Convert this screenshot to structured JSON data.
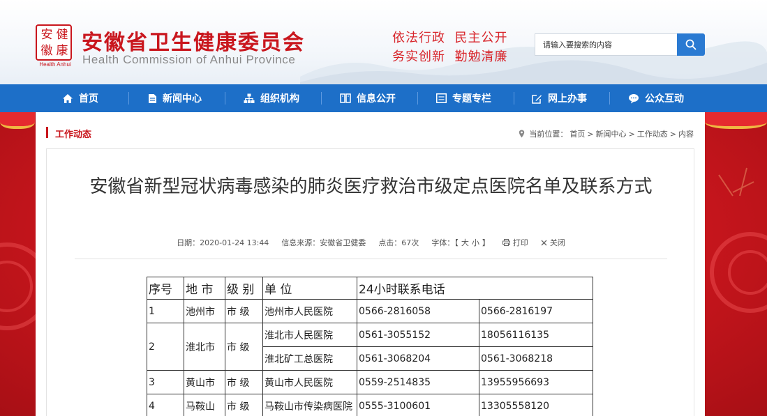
{
  "header": {
    "logo_chars": [
      "安",
      "健",
      "徽",
      "康"
    ],
    "logo_sub": "Health Anhui",
    "site_title": "安徽省卫生健康委员会",
    "site_en": "Health Commission of Anhui Province",
    "slogan_line1": "依法行政  民主公开",
    "slogan_line2": "务实创新  勤勉清廉",
    "search": {
      "placeholder": "请输入要搜索的内容",
      "icon": "search-icon"
    }
  },
  "nav": {
    "items": [
      {
        "label": "首页",
        "icon": "home-icon"
      },
      {
        "label": "新闻中心",
        "icon": "document-icon"
      },
      {
        "label": "组织机构",
        "icon": "org-chart-icon"
      },
      {
        "label": "信息公开",
        "icon": "book-icon"
      },
      {
        "label": "专题专栏",
        "icon": "list-icon"
      },
      {
        "label": "网上办事",
        "icon": "edit-icon"
      },
      {
        "label": "公众互动",
        "icon": "chat-icon"
      }
    ]
  },
  "section": {
    "title": "工作动态",
    "breadcrumb": {
      "prefix": "当前位置：",
      "items": [
        "首页",
        "新闻中心",
        "工作动态",
        "内容"
      ],
      "separator": ">"
    }
  },
  "article": {
    "title": "安徽省新型冠状病毒感染的肺炎医疗救治市级定点医院名单及联系方式",
    "date": "日期：2020-01-24 13:44",
    "source": "信息来源：安徽省卫健委",
    "clicks": "点击：67次",
    "font_label": "字体：【",
    "font_large": "大",
    "font_small": "小",
    "font_end": "】",
    "print": "打印",
    "close": "关闭"
  },
  "table": {
    "headers": [
      "序号",
      "地 市",
      "级 别",
      "单 位",
      "24小时联系电话"
    ],
    "rows": [
      {
        "no": "1",
        "city": "池州市",
        "level": "市 级",
        "units": [
          {
            "name": "池州市人民医院",
            "phone1": "0566-2816058",
            "phone2": "0566-2816197"
          }
        ]
      },
      {
        "no": "2",
        "city": "淮北市",
        "level": "市 级",
        "units": [
          {
            "name": "淮北市人民医院",
            "phone1": "0561-3055152",
            "phone2": "18056116135"
          },
          {
            "name": "淮北矿工总医院",
            "phone1": "0561-3068204",
            "phone2": "0561-3068218"
          }
        ]
      },
      {
        "no": "3",
        "city": "黄山市",
        "level": "市 级",
        "units": [
          {
            "name": "黄山市人民医院",
            "phone1": "0559-2514835",
            "phone2": "13955956693"
          }
        ]
      },
      {
        "no": "4",
        "city": "马鞍山",
        "level": "市 级",
        "units": [
          {
            "name": "马鞍山市传染病医院",
            "phone1": "0555-3100601",
            "phone2": "13305558120"
          }
        ]
      }
    ]
  },
  "colors": {
    "brand_red": "#c9161d",
    "nav_blue": "#1d6fc8",
    "search_blue": "#2a7ad2"
  }
}
